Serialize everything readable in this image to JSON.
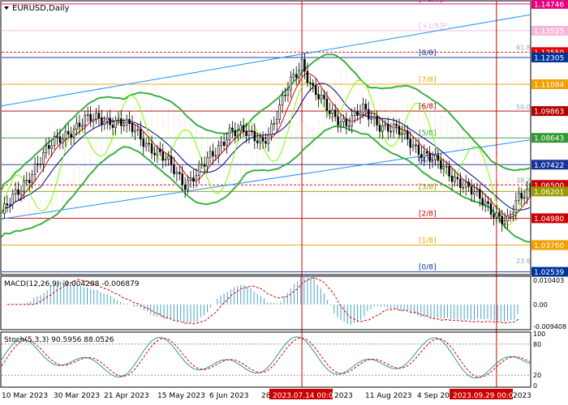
{
  "chart_data": [
    {
      "type": "candlestick",
      "title": "EURUSD,Daily",
      "ylim": [
        1.0245,
        1.1485
      ],
      "price_axis_labels": [
        {
          "value": 1.14746,
          "text": "1.14746",
          "color": "#e6007e"
        },
        {
          "value": 1.13525,
          "text": "1.13525",
          "color": "#f5b8d6"
        },
        {
          "value": 1.1255,
          "text": "1.12550",
          "color": "#e00000"
        },
        {
          "value": 1.12305,
          "text": "1.12305",
          "color": "#003399"
        },
        {
          "value": 1.11084,
          "text": "1.11084",
          "color": "#f0a000"
        },
        {
          "value": 1.09863,
          "text": "1.09863",
          "color": "#b00000"
        },
        {
          "value": 1.08643,
          "text": "1.08643",
          "color": "#339933"
        },
        {
          "value": 1.07422,
          "text": "1.07422",
          "color": "#1a3399"
        },
        {
          "value": 1.065,
          "text": "1.06500",
          "color": "#cc0000"
        },
        {
          "value": 1.06201,
          "text": "1.06201",
          "color": "#999900"
        },
        {
          "value": 1.0498,
          "text": "1.04980",
          "color": "#cc0000"
        },
        {
          "value": 1.0376,
          "text": "1.03760",
          "color": "#f0a000"
        },
        {
          "value": 1.02539,
          "text": "1.02539",
          "color": "#003399"
        }
      ],
      "murrey_levels": [
        {
          "label": "[+2/8]P",
          "value": 1.14746,
          "color": "#e6007e"
        },
        {
          "label": "[+1/8]P",
          "value": 1.13525,
          "color": "#f5b8d6"
        },
        {
          "label": "[8/8]",
          "value": 1.12305,
          "color": "#003399"
        },
        {
          "label": "[7/8]",
          "value": 1.11084,
          "color": "#f0a000"
        },
        {
          "label": "[6/8]",
          "value": 1.09863,
          "color": "#b00000"
        },
        {
          "label": "[5/8]",
          "value": 1.08643,
          "color": "#339933"
        },
        {
          "label": "[4/8]",
          "value": 1.07422,
          "color": "#1a3399"
        },
        {
          "label": "[3/8]",
          "value": 1.06201,
          "color": "#999900"
        },
        {
          "label": "[2/8]",
          "value": 1.0498,
          "color": "#cc0000"
        },
        {
          "label": "[1/8]",
          "value": 1.0376,
          "color": "#f0a000"
        },
        {
          "label": "[0/8]",
          "value": 1.02539,
          "color": "#003399"
        }
      ],
      "fibonacci_labels": [
        {
          "text": "61.8",
          "value": 1.1255
        },
        {
          "text": "50.0",
          "value": 1.0983
        },
        {
          "text": "38.2",
          "value": 1.065
        },
        {
          "text": "23.6",
          "value": 1.0282
        }
      ],
      "dates": [
        "10 Mar 2023",
        "30 Mar 2023",
        "21 Apr 2023",
        "15 May 2023",
        "6 Jun 2023",
        "28",
        "2023.07.14 00:00",
        "2023",
        "11 Aug 2023",
        "4 Sep 20",
        "2023.09.29 00:00",
        "2023"
      ],
      "highlighted_dates": [
        "2023.07.14 00:00",
        "2023.09.29 00:00"
      ],
      "close_path": [
        [
          0,
          1.052
        ],
        [
          6,
          1.0615
        ],
        [
          12,
          1.0735
        ],
        [
          18,
          1.083
        ],
        [
          24,
          1.0895
        ],
        [
          30,
          1.094
        ],
        [
          36,
          1.0955
        ],
        [
          42,
          1.0935
        ],
        [
          48,
          1.0895
        ],
        [
          54,
          1.082
        ],
        [
          60,
          1.0745
        ],
        [
          66,
          1.066
        ],
        [
          70,
          1.07
        ],
        [
          76,
          1.0785
        ],
        [
          82,
          1.09
        ],
        [
          88,
          1.088
        ],
        [
          94,
          1.0855
        ],
        [
          98,
          1.093
        ],
        [
          104,
          1.112
        ],
        [
          108,
          1.1215
        ],
        [
          112,
          1.108
        ],
        [
          118,
          1.098
        ],
        [
          124,
          1.0935
        ],
        [
          130,
          1.0985
        ],
        [
          136,
          1.093
        ],
        [
          142,
          1.0895
        ],
        [
          148,
          1.0835
        ],
        [
          154,
          1.0775
        ],
        [
          160,
          1.071
        ],
        [
          166,
          1.066
        ],
        [
          172,
          1.058
        ],
        [
          178,
          1.052
        ],
        [
          182,
          1.0485
        ],
        [
          186,
          1.058
        ],
        [
          190,
          1.063
        ]
      ],
      "up_channel": {
        "from": [
          0,
          1.0495
        ],
        "to": [
          190,
          1.0855
        ]
      },
      "up_channel_upper": {
        "from": [
          0,
          1.101
        ],
        "to": [
          190,
          1.1425
        ]
      },
      "vertical_markers": [
        108,
        178
      ]
    },
    {
      "type": "bar",
      "title": "MACD(12,26,9) -0.004288 -0.006879",
      "ylim": [
        -0.0105,
        0.0115
      ],
      "axis_labels": [
        "0.010403",
        "0.00",
        "-0.009408"
      ],
      "signal_line": "dashed red"
    },
    {
      "type": "line",
      "title": "Stoch(5,3,3) 90.5956 88.0526",
      "ylim": [
        0,
        100
      ],
      "axis_labels": [
        "100",
        "80",
        "20",
        "0"
      ],
      "levels": [
        80,
        20
      ]
    }
  ]
}
